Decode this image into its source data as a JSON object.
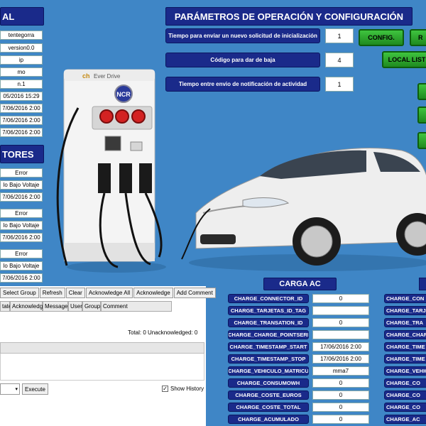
{
  "left": {
    "panel1_title": "AL",
    "info_values": [
      "tentegorra",
      "version0.0",
      "ip",
      "mo",
      "n.1",
      "05/2016 15:29",
      "7/06/2016 2:00",
      "7/06/2016 2:00",
      "7/06/2016 2:00"
    ],
    "panel2_title": "TORES",
    "alarm_values": [
      "Error",
      "lo Bajo Voltaje",
      "7/06/2016 2:00",
      "Error",
      "lo Bajo Voltaje",
      "7/06/2016 2:00",
      "Error",
      "lo Bajo Voltaje",
      "7/06/2016 2:00"
    ]
  },
  "toolbar": {
    "buttons": [
      "Select Group",
      "Refresh",
      "Clear",
      "Acknowledge All",
      "Acknowledge",
      "Add Comment"
    ],
    "columns": [
      "tate",
      "Acknowledged",
      "Message",
      "User",
      "Group",
      "Comment"
    ],
    "total_text": "Total: 0   Unacknowledged: 0",
    "execute_label": "Execute",
    "show_history_label": "Show History",
    "show_history_checked": true
  },
  "params": {
    "title": "PARÁMETROS DE OPERACIÓN Y CONFIGURACIÓN",
    "rows": [
      {
        "label": "Tiempo para enviar un nuevo solicitud de inicialización",
        "value": "1"
      },
      {
        "label": "Código para dar de baja",
        "value": "4"
      },
      {
        "label": "Tiempo entre envio de notificación de actividad",
        "value": "1"
      }
    ],
    "config_button": "CONFIG.",
    "second_button": "R",
    "local_list_button": "LOCAL LIST"
  },
  "charger": {
    "brand": "Ever Drive",
    "logo_text": "NCR"
  },
  "carga_ac": {
    "title": "CARGA AC",
    "rows": [
      {
        "label": "CHARGE_CONNECTOR_ID",
        "value": "0"
      },
      {
        "label": "CHARGE_TARJETAS_ID_TAG",
        "value": ""
      },
      {
        "label": "CHARGE_TRANSATION_ID",
        "value": "0"
      },
      {
        "label": "CHARGE_CHARGE_POINTSERI",
        "value": ""
      },
      {
        "label": "CHARGE_TIMESTAMP_START",
        "value": "17/06/2016 2:00"
      },
      {
        "label": "CHARGE_TIMESTAMP_STOP",
        "value": "17/06/2016 2:00"
      },
      {
        "label": "CHARGE_VEHICULO_MATRICU",
        "value": "mma7"
      },
      {
        "label": "CHARGE_CONSUMOWH",
        "value": "0"
      },
      {
        "label": "CHARGE_COSTE_EUROS",
        "value": "0"
      },
      {
        "label": "CHARGE_COSTE_TOTAL",
        "value": "0"
      },
      {
        "label": "CHARGE_ACUMULADO",
        "value": "0"
      }
    ]
  },
  "right_col": {
    "rows": [
      "CHARGE_CON",
      "CHARGE_TARJ",
      "CHARGE_TRA",
      "CHARGE_CHAR",
      "CHARGE_TIME",
      "CHARGE_TIME",
      "CHARGE_VEHIC",
      "CHARGE_CO",
      "CHARGE_CO",
      "CHARGE_CO",
      "CHARGE_AC"
    ]
  },
  "colors": {
    "background": "#3f86c6",
    "navy": "#1a2a8a",
    "green": "#2fa82f"
  }
}
